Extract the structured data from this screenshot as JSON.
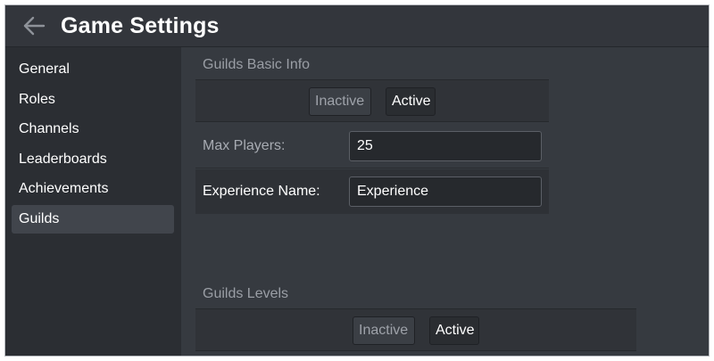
{
  "header": {
    "back_icon": "arrow-left-icon",
    "title": "Game Settings"
  },
  "sidebar": {
    "items": [
      {
        "label": "General",
        "selected": false
      },
      {
        "label": "Roles",
        "selected": false
      },
      {
        "label": "Channels",
        "selected": false
      },
      {
        "label": "Leaderboards",
        "selected": false
      },
      {
        "label": "Achievements",
        "selected": false
      },
      {
        "label": "Guilds",
        "selected": true
      }
    ]
  },
  "basic_info": {
    "title": "Guilds Basic Info",
    "toggle": {
      "inactive_label": "Inactive",
      "active_label": "Active",
      "selected": "Active"
    },
    "max_players": {
      "label": "Max Players:",
      "value": "25"
    },
    "experience_name": {
      "label": "Experience Name:",
      "value": "Experience"
    }
  },
  "levels": {
    "title": "Guilds Levels",
    "toggle": {
      "inactive_label": "Inactive",
      "active_label": "Active",
      "selected": "Active"
    }
  },
  "colors": {
    "background": "#363a40",
    "sidebar": "#2b2e33",
    "selected_item": "#41454c",
    "text": "#ffffff",
    "muted_text": "#9a9ea5"
  }
}
